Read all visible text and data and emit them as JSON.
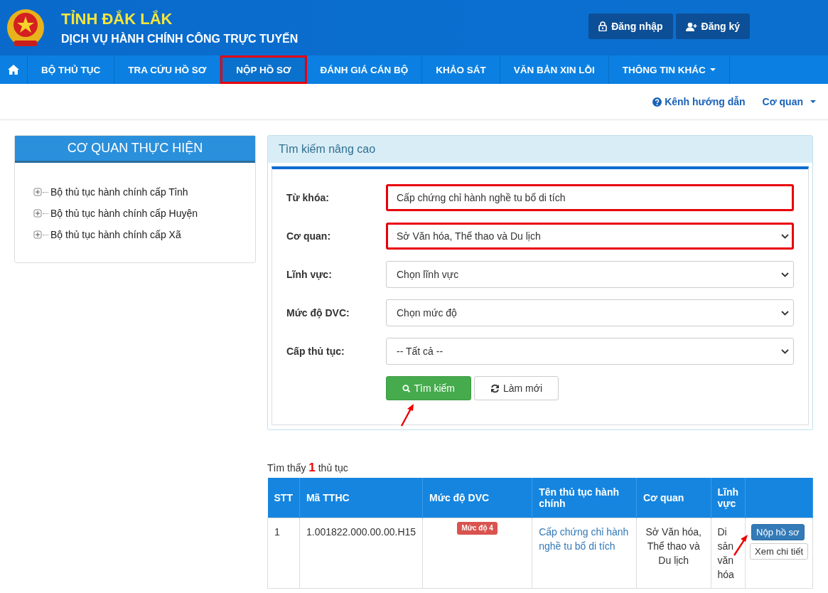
{
  "header": {
    "title": "TỈNH ĐẮK LẮK",
    "subtitle": "DỊCH VỤ HÀNH CHÍNH CÔNG TRỰC TUYẾN",
    "buttons": [
      {
        "kind": "login",
        "label": "Đăng nhập"
      },
      {
        "kind": "register",
        "label": "Đăng ký"
      }
    ]
  },
  "nav": {
    "items": [
      {
        "label": "BỘ THỦ TỤC",
        "dropdown": false,
        "highlighted": false
      },
      {
        "label": "TRA CỨU HỒ SƠ",
        "dropdown": false,
        "highlighted": false
      },
      {
        "label": "NỘP HỒ SƠ",
        "dropdown": false,
        "highlighted": true
      },
      {
        "label": "ĐÁNH GIÁ CÁN BỘ",
        "dropdown": false,
        "highlighted": false
      },
      {
        "label": "KHẢO SÁT",
        "dropdown": false,
        "highlighted": false
      },
      {
        "label": "VĂN BẢN XIN LỖI",
        "dropdown": false,
        "highlighted": false
      },
      {
        "label": "THÔNG TIN KHÁC",
        "dropdown": true,
        "highlighted": false
      }
    ]
  },
  "subbar": {
    "guide": "Kênh hướng dẫn",
    "agency": "Cơ quan"
  },
  "sidebar": {
    "title": "CƠ QUAN THỰC HIỆN",
    "items": [
      {
        "label": "Bộ thủ tục hành chính cấp Tỉnh",
        "expanded": false
      },
      {
        "label": "Bộ thủ tục hành chính cấp Huyện",
        "expanded": false
      },
      {
        "label": "Bộ thủ tục hành chính cấp Xã",
        "expanded": false
      }
    ]
  },
  "search": {
    "title": "Tìm kiếm nâng cao",
    "fields": [
      {
        "kind": "text",
        "label": "Từ khóa:",
        "value": "Cấp chứng chỉ hành nghề tu bổ di tích",
        "highlighted": true
      },
      {
        "kind": "select",
        "label": "Cơ quan:",
        "value": "Sở Văn hóa, Thể thao và Du lịch",
        "highlighted": true
      },
      {
        "kind": "select",
        "label": "Lĩnh vực:",
        "value": "Chọn lĩnh vực",
        "highlighted": false
      },
      {
        "kind": "select",
        "label": "Mức độ DVC:",
        "value": "Chọn mức độ",
        "highlighted": false
      },
      {
        "kind": "select",
        "label": "Cấp thủ tục:",
        "value": "-- Tất cả --",
        "highlighted": false
      }
    ],
    "search_button": {
      "label": "Tìm kiếm",
      "arrow": true
    },
    "reset_button": {
      "label": "Làm mới"
    }
  },
  "results": {
    "summary": "Tìm thấy **1** thủ tục",
    "columns": [
      "STT",
      "Mã TTHC",
      "Mức độ DVC",
      "Tên thủ tục hành chính",
      "Cơ quan",
      "Lĩnh vực"
    ],
    "rows": [
      {
        "stt": "1",
        "code": "1.001822.000.00.00.H15",
        "level_badge": "Mức độ 4",
        "name": "Cấp chứng chỉ hành nghề tu bổ di tích",
        "agency": "Sở Văn hóa, Thể thao và Du lịch",
        "field": "Di sản văn hóa",
        "submit": {
          "label": "Nộp hồ sơ",
          "arrow": true
        },
        "details": "Xem chi tiết"
      }
    ]
  }
}
